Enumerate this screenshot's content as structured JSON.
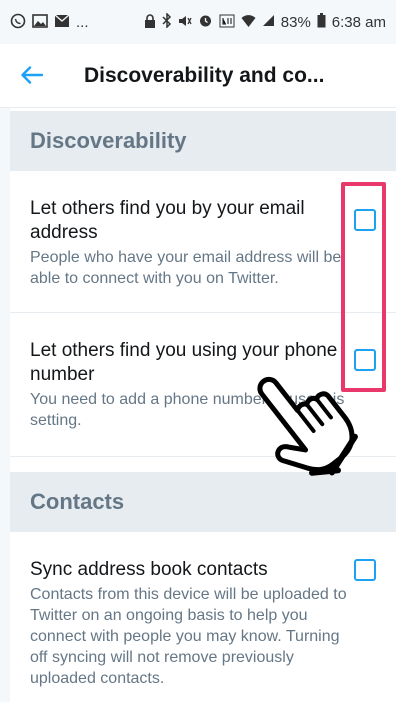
{
  "status_bar": {
    "battery": "83%",
    "time": "6:38 am",
    "icons": [
      "whatsapp-icon",
      "image-icon",
      "mail-icon",
      "lock-icon",
      "bluetooth-icon",
      "mute-icon",
      "alarm-icon",
      "lte-icon",
      "wifi-icon",
      "signal-icon",
      "battery-icon"
    ],
    "more": "..."
  },
  "app_bar": {
    "back_icon": "arrow-left-icon",
    "title": "Discoverability and co..."
  },
  "sections": {
    "discoverability": {
      "header": "Discoverability",
      "email": {
        "title": "Let others find you by your email address",
        "description": "People who have your email address will be able to connect with you on Twitter.",
        "checked": false
      },
      "phone": {
        "title": "Let others find you using your phone number",
        "description": "You need to add a phone number to use this setting.",
        "checked": false
      }
    },
    "contacts": {
      "header": "Contacts",
      "sync": {
        "title": "Sync address book contacts",
        "description": "Contacts from this device will be uploaded to Twitter on an ongoing basis to help you connect with people you may know. Turning off syncing will not remove previously uploaded contacts.",
        "checked": false
      }
    }
  },
  "colors": {
    "accent": "#1da1f2",
    "highlight": "#e8386c",
    "section_bg": "#e6ecf0",
    "muted_text": "#657786"
  }
}
